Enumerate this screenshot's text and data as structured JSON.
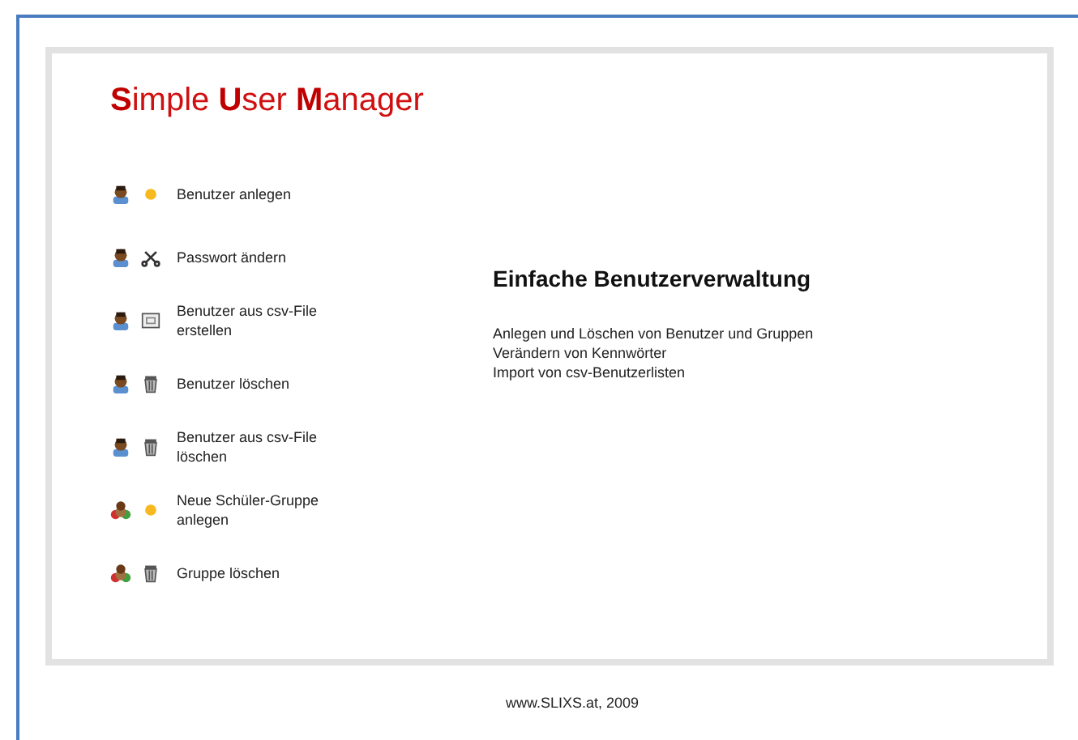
{
  "header": {
    "title": "**S**imple **U**ser **M**anager"
  },
  "menu": [
    {
      "label": "Benutzer anlegen",
      "kind": "user-add"
    },
    {
      "label": "Passwort ändern",
      "kind": "user-password"
    },
    {
      "label": "Benutzer aus csv-File erstellen",
      "kind": "user-import"
    },
    {
      "label": "Benutzer löschen",
      "kind": "user-delete"
    },
    {
      "label": "Benutzer aus csv-File löschen",
      "kind": "user-delete"
    },
    {
      "label": "Neue Schüler-Gruppe anlegen",
      "kind": "group-add"
    },
    {
      "label": "Gruppe löschen",
      "kind": "group-delete"
    }
  ],
  "intro": {
    "heading": "Einfache Benutzerverwaltung",
    "lines": [
      "Anlegen und Löschen von Benutzer und Gruppen",
      "Verändern von Kennwörter",
      "Import von csv-Benutzerlisten"
    ]
  },
  "footer": {
    "text": "www.SLIXS.at, 2009"
  }
}
